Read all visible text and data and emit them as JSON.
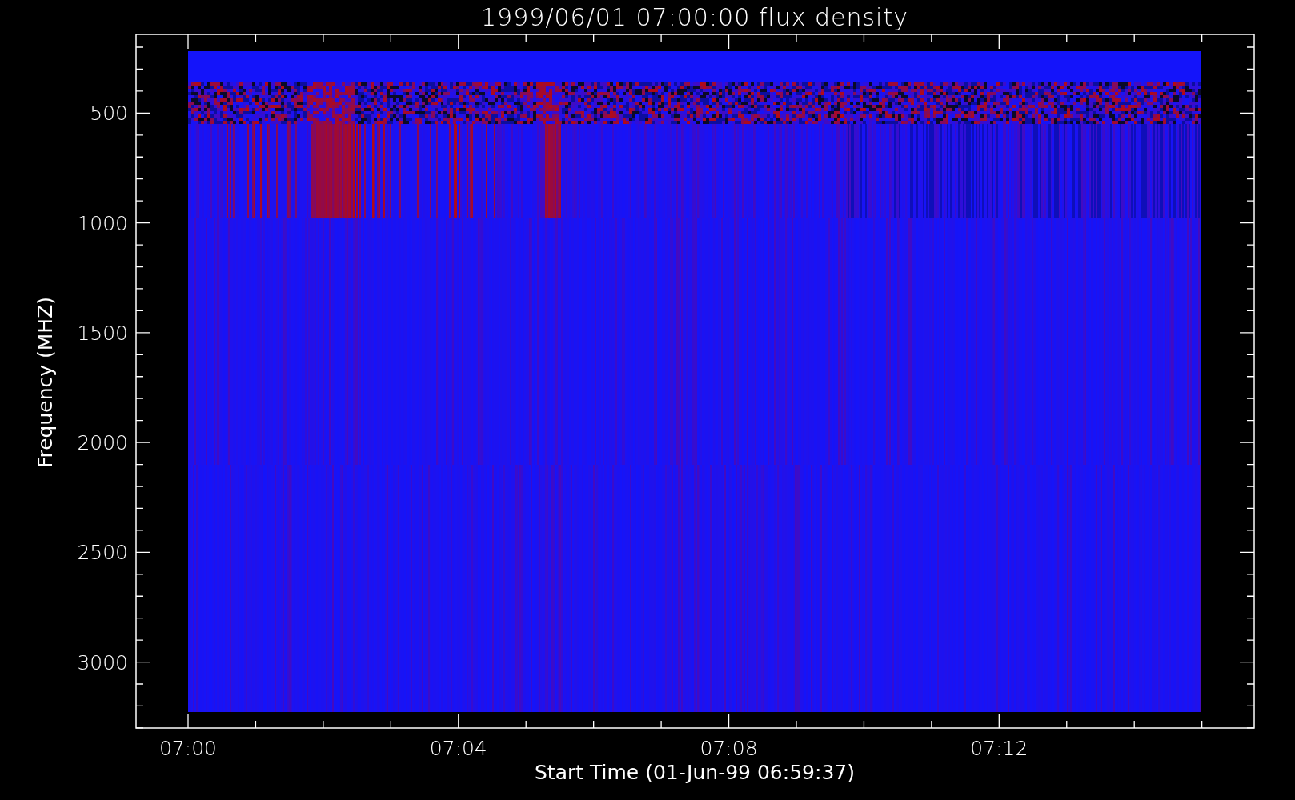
{
  "title": "1999/06/01 07:00:00 flux density",
  "x_axis": {
    "label": "Start Time (01-Jun-99 06:59:37)",
    "ticks": [
      "07:00",
      "07:04",
      "07:08",
      "07:12"
    ]
  },
  "y_axis": {
    "label": "Frequency (MHZ)",
    "ticks": [
      "500",
      "1000",
      "1500",
      "2000",
      "2500",
      "3000"
    ]
  }
}
